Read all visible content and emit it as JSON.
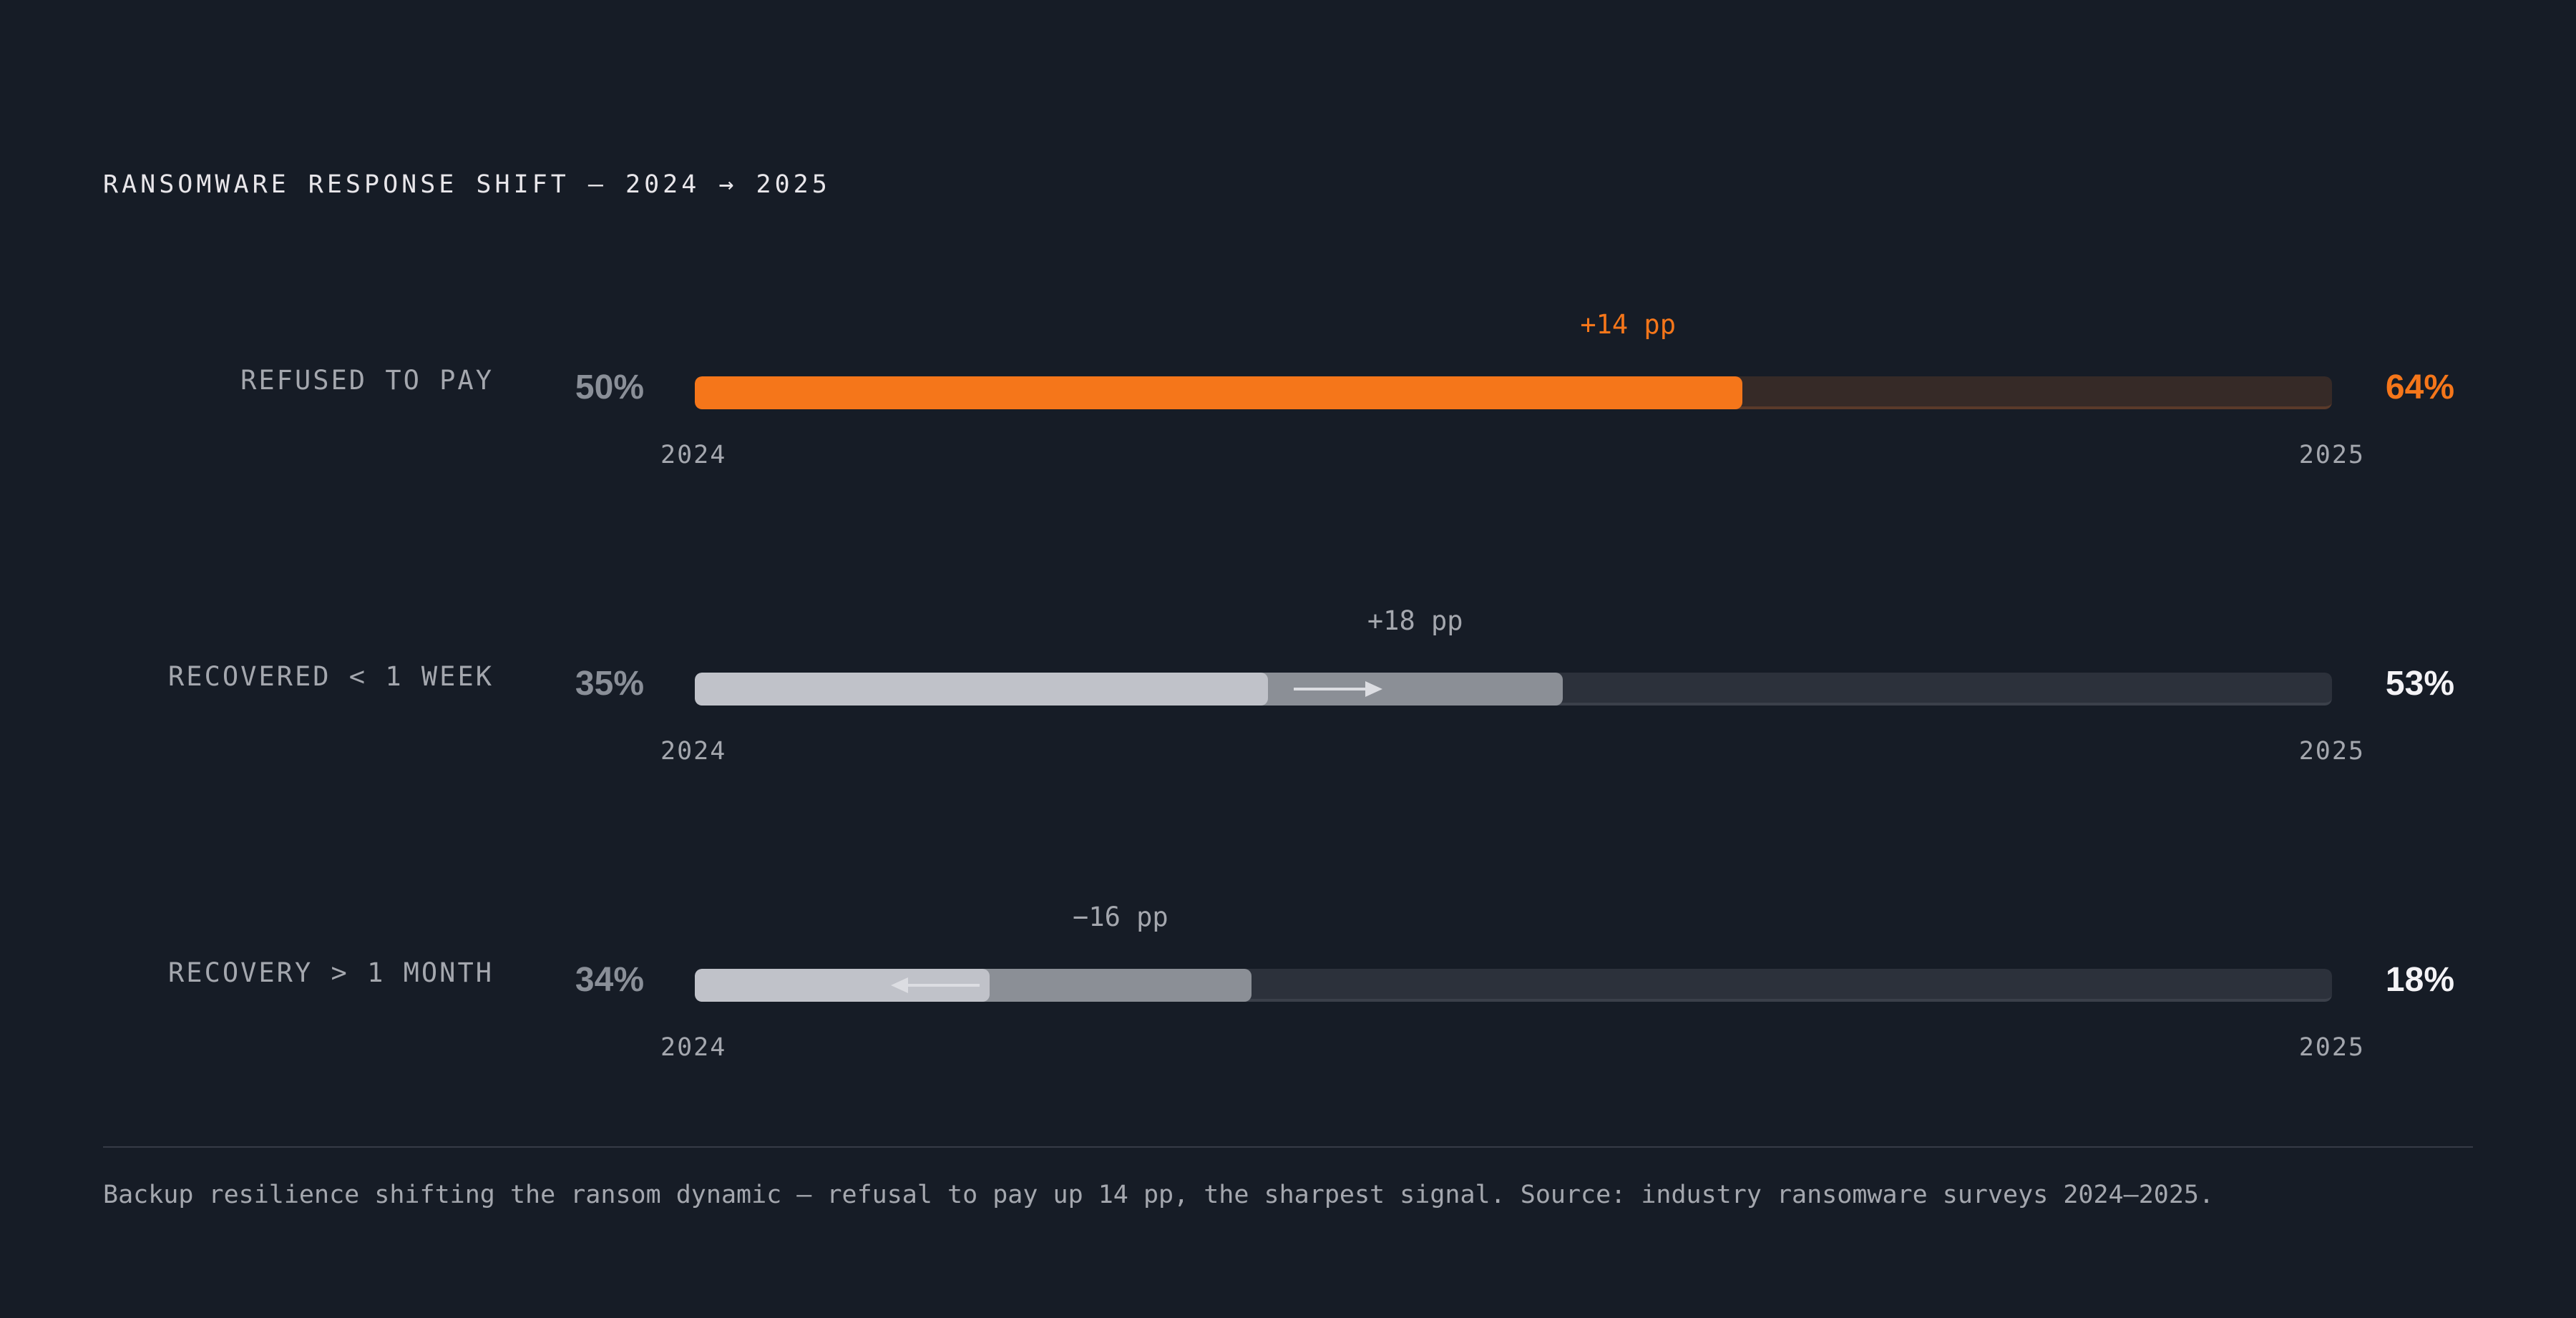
{
  "title": "RANSOMWARE RESPONSE SHIFT — 2024 → 2025",
  "footnote": "Backup resilience shifting the ransom dynamic — refusal to pay up 14 pp, the sharpest signal. Source: industry ransomware surveys 2024–2025.",
  "colors": {
    "background": "#161c26",
    "accent": "#f5761a",
    "neutral_start": "#c0c2c9",
    "neutral_end": "#8b8f96",
    "track": "#2c313b"
  },
  "chart_data": {
    "type": "bar",
    "title": "RANSOMWARE RESPONSE SHIFT — 2024 → 2025",
    "xlim": [
      0,
      100
    ],
    "start_year": "2024",
    "end_year": "2025",
    "rows": [
      {
        "label": "REFUSED TO PAY",
        "start_label": "50%",
        "end_label": "64%",
        "start": 50,
        "end": 64,
        "delta_label": "+14 pp",
        "highlight": true
      },
      {
        "label": "RECOVERED < 1 WEEK",
        "start_label": "35%",
        "end_label": "53%",
        "start": 35,
        "end": 53,
        "delta_label": "+18 pp",
        "highlight": false
      },
      {
        "label": "RECOVERY > 1 MONTH",
        "start_label": "34%",
        "end_label": "18%",
        "start": 34,
        "end": 18,
        "delta_label": "−16 pp",
        "highlight": false
      }
    ]
  }
}
